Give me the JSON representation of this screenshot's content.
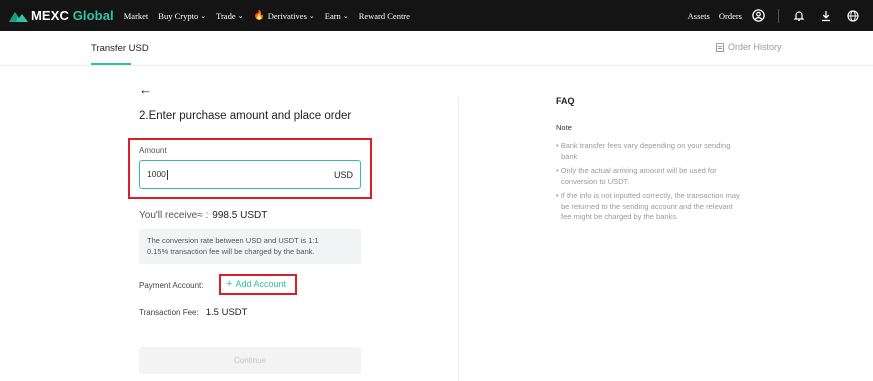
{
  "nav": {
    "logo_main": "MEXC",
    "logo_accent": "Global",
    "links": [
      {
        "label": "Market",
        "chevron": false
      },
      {
        "label": "Buy Crypto",
        "chevron": true
      },
      {
        "label": "Trade",
        "chevron": true
      },
      {
        "label": "Derivatives",
        "chevron": true,
        "fire": true
      },
      {
        "label": "Earn",
        "chevron": true
      },
      {
        "label": "Reward Centre",
        "chevron": false
      }
    ],
    "right": {
      "assets": "Assets",
      "orders": "Orders"
    },
    "icons": [
      "user-icon",
      "bell-icon",
      "download-icon",
      "globe-icon"
    ]
  },
  "subheader": {
    "tab": "Transfer USD",
    "order_history": "Order History"
  },
  "form": {
    "back": "←",
    "title": "2.Enter purchase amount and place order",
    "amount_label": "Amount",
    "amount_value": "1000",
    "amount_unit": "USD",
    "receive_label": "You'll receive≈ :",
    "receive_value": "998.5 USDT",
    "note_line1": "The conversion rate between USD and USDT is 1:1",
    "note_line2": "0.15% transaction fee will be charged by the bank.",
    "payment_label": "Payment Account:",
    "add_account": "Add Account",
    "fee_label": "Transaction Fee:",
    "fee_value": "1.5 USDT",
    "continue": "Continue"
  },
  "faq": {
    "title": "FAQ",
    "note": "Note",
    "items": [
      "• Bank transfer fees vary depending on your sending bank",
      "• Only the actual arriving amount will be used for conversion to USDT.",
      "• If the info is not inputted correctly, the transaction may be returned to the sending account and the relevant fee might be charged by the banks."
    ]
  },
  "colors": {
    "accent": "#2fc3a4",
    "highlight": "#d9202a",
    "nav_bg": "#141414"
  }
}
